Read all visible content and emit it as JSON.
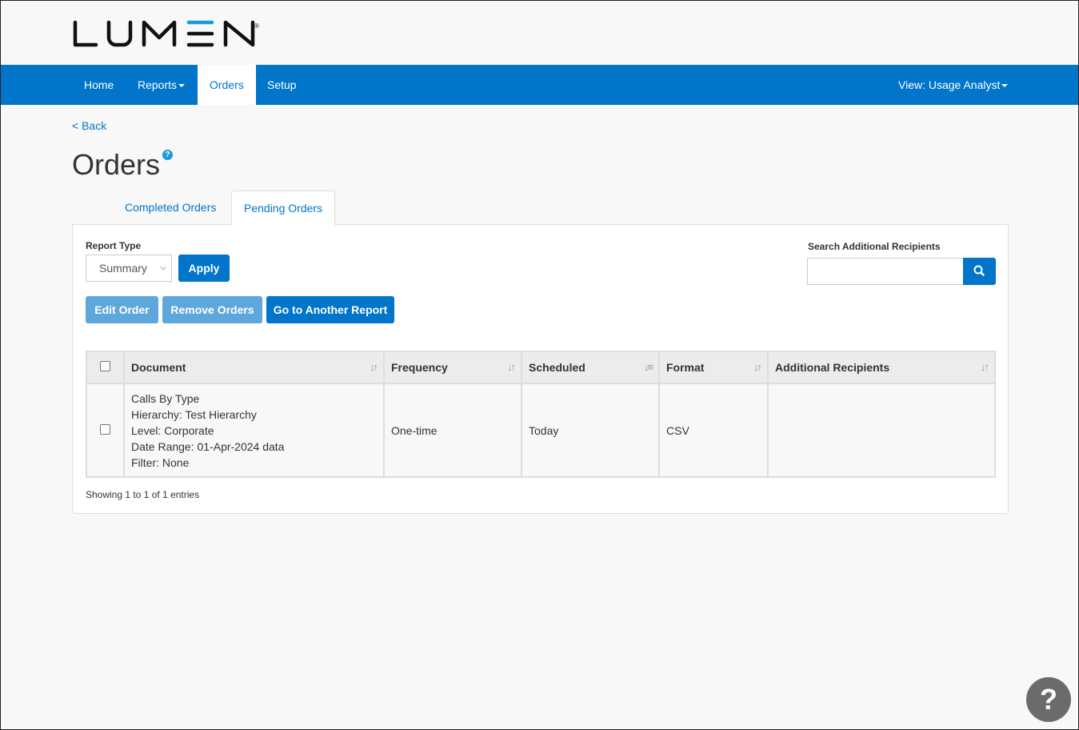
{
  "brand": {
    "name": "LUMEN",
    "accent": "#1a9ad6",
    "nav_color": "#0075c9"
  },
  "nav": {
    "items": [
      {
        "label": "Home",
        "dropdown": false,
        "active": false
      },
      {
        "label": "Reports",
        "dropdown": true,
        "active": false
      },
      {
        "label": "Orders",
        "dropdown": false,
        "active": true
      },
      {
        "label": "Setup",
        "dropdown": false,
        "active": false
      }
    ],
    "view_label": "View: Usage Analyst"
  },
  "page": {
    "back_label": "< Back",
    "title": "Orders",
    "help_icon": "?"
  },
  "tabs": [
    {
      "label": "Completed Orders",
      "active": false
    },
    {
      "label": "Pending Orders",
      "active": true
    }
  ],
  "filters": {
    "report_type_label": "Report Type",
    "report_type_value": "Summary",
    "apply_label": "Apply",
    "search_label": "Search Additional Recipients",
    "search_value": ""
  },
  "actions": {
    "edit_label": "Edit Order",
    "remove_label": "Remove Orders",
    "goto_label": "Go to Another Report"
  },
  "table": {
    "columns": [
      "Document",
      "Frequency",
      "Scheduled",
      "Format",
      "Additional Recipients"
    ],
    "rows": [
      {
        "document": [
          "Calls By Type",
          "Hierarchy: Test Hierarchy",
          "Level: Corporate",
          "Date Range: 01-Apr-2024 data",
          "Filter: None"
        ],
        "frequency": "One-time",
        "scheduled": "Today",
        "format": "CSV",
        "recipients": ""
      }
    ],
    "showing": "Showing 1 to 1 of 1 entries"
  },
  "help_fab": "?"
}
